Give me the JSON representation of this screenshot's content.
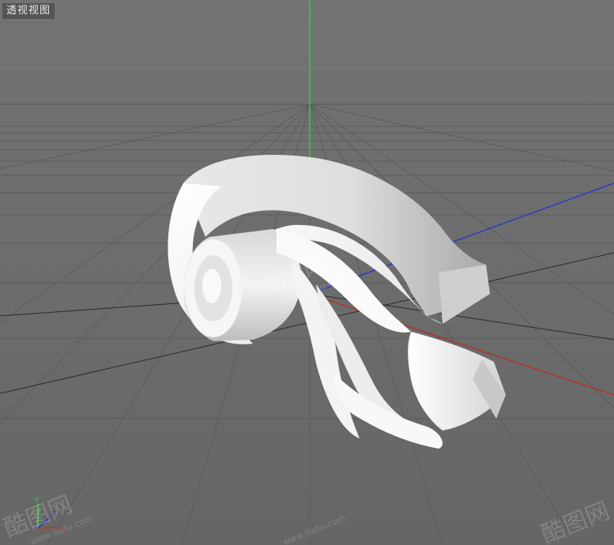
{
  "viewport": {
    "label": "透视视图",
    "colors": {
      "background_top": "#727272",
      "background_bottom": "#6a6a6a",
      "grid": "#5d5d5d",
      "grid_major": "#2a2a2a",
      "axis_x": "#c0392b",
      "axis_y": "#2ecc40",
      "axis_z": "#2c3cc0",
      "model": "#f2f2f2",
      "model_shade": "#b8b8b8"
    },
    "axis_gizmo": {
      "y_label": "Y",
      "x_label": "X",
      "z_label": "Z"
    }
  },
  "watermarks": [
    {
      "brand": "酷图网",
      "url": "www.ikutu.com"
    },
    {
      "brand": "酷图网",
      "url": "www.ikutu.com"
    },
    {
      "brand": "酷图网",
      "url": "www.ikutu.com"
    }
  ]
}
